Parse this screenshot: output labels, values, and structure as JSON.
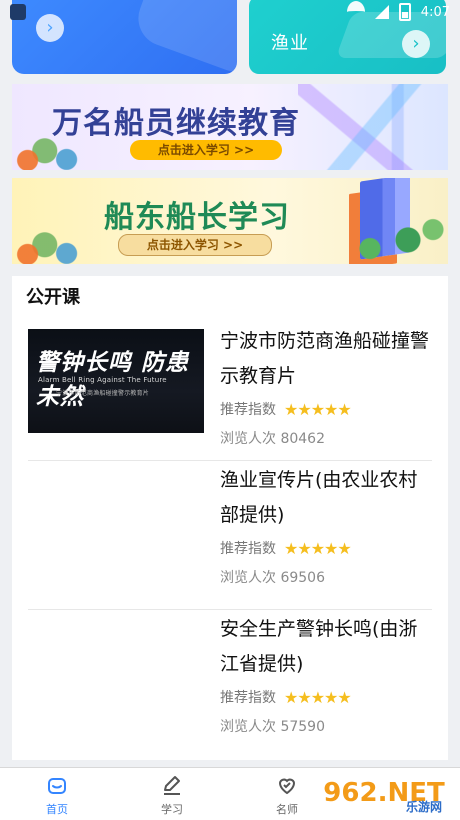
{
  "status_bar": {
    "time": "4:07"
  },
  "top_cards": {
    "left_arrow": "›",
    "right_title": "渔业",
    "right_arrow": "›"
  },
  "banners": [
    {
      "title": "万名船员继续教育",
      "button": "点击进入学习 >>"
    },
    {
      "title": "船东船长学习",
      "button": "点击进入学习 >>"
    }
  ],
  "course_section": {
    "title": "公开课",
    "items": [
      {
        "thumb_title": "警钟长鸣 防患未然",
        "thumb_subtitle": "Alarm Bell Ring Against The Future",
        "thumb_caption": "宁波市防范商渔船碰撞警示教育片",
        "title": "宁波市防范商渔船碰撞警示教育片",
        "rating_label": "推荐指数",
        "stars": "★★★★★",
        "views": "浏览人次 80462"
      },
      {
        "title": "渔业宣传片(由农业农村部提供)",
        "rating_label": "推荐指数",
        "stars": "★★★★★",
        "views": "浏览人次 69506"
      },
      {
        "title": "安全生产警钟长鸣(由浙江省提供)",
        "rating_label": "推荐指数",
        "stars": "★★★★★",
        "views": "浏览人次 57590"
      }
    ]
  },
  "bottom_nav": {
    "home": "首页",
    "study": "学习",
    "teacher": "名师"
  },
  "watermark": {
    "brand": "962.NET",
    "sub": "乐游网"
  },
  "colors": {
    "accent_blue": "#3485ff",
    "teal": "#1fd0cf",
    "star": "#f5be1f"
  }
}
